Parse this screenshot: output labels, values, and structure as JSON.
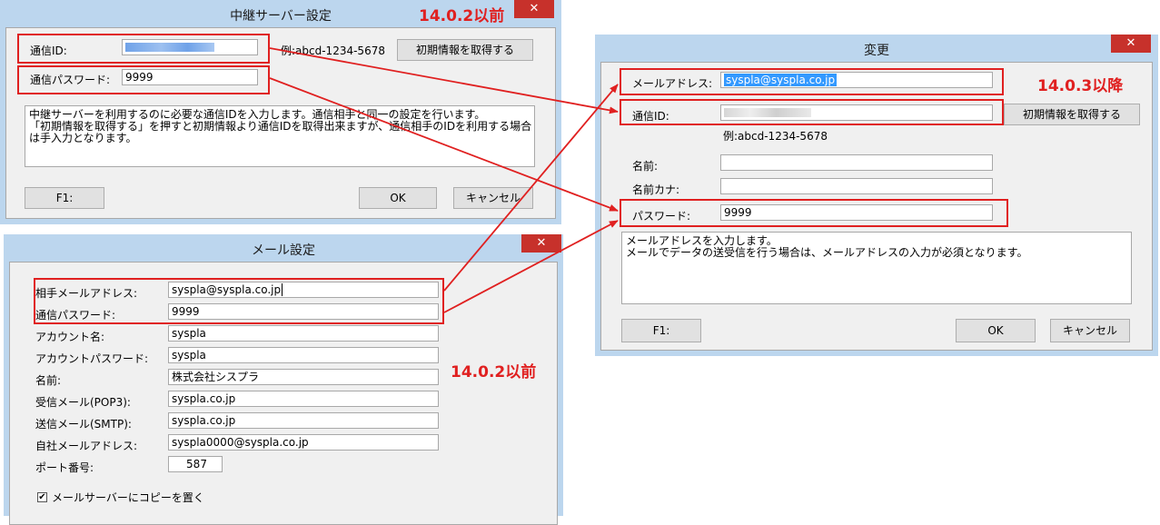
{
  "relay_dialog": {
    "title": "中継サーバー設定",
    "id_label": "通信ID:",
    "id_example": "例:abcd-1234-5678",
    "get_info_button": "初期情報を取得する",
    "password_label": "通信パスワード:",
    "password_value": "9999",
    "help_lines": [
      "中継サーバーを利用するのに必要な通信IDを入力します。通信相手と同一の設定を行います。",
      "「初期情報を取得する」を押すと初期情報より通信IDを取得出来ますが、通信相手のIDを利用する場合",
      "は手入力となります。"
    ],
    "f1_button": "F1:",
    "ok_button": "OK",
    "cancel_button": "キャンセル",
    "version_note": "14.0.2以前"
  },
  "change_dialog": {
    "title": "変更",
    "version_note": "14.0.3以降",
    "email_label": "メールアドレス:",
    "email_value": "syspla@syspla.co.jp",
    "id_label": "通信ID:",
    "get_info_button": "初期情報を取得する",
    "id_example": "例:abcd-1234-5678",
    "name_label": "名前:",
    "name_value": "",
    "kana_label": "名前カナ:",
    "kana_value": "",
    "password_label": "パスワード:",
    "password_value": "9999",
    "help_lines": [
      "メールアドレスを入力します。",
      "メールでデータの送受信を行う場合は、メールアドレスの入力が必須となります。"
    ],
    "f1_button": "F1:",
    "ok_button": "OK",
    "cancel_button": "キャンセル"
  },
  "mail_dialog": {
    "title": "メール設定",
    "version_note": "14.0.2以前",
    "fields": [
      {
        "label": "相手メールアドレス:",
        "value": "syspla@syspla.co.jp"
      },
      {
        "label": "通信パスワード:",
        "value": "9999"
      },
      {
        "label": "アカウント名:",
        "value": "syspla"
      },
      {
        "label": "アカウントパスワード:",
        "value": "syspla"
      },
      {
        "label": "名前:",
        "value": "株式会社シスプラ"
      },
      {
        "label": "受信メール(POP3):",
        "value": "syspla.co.jp"
      },
      {
        "label": "送信メール(SMTP):",
        "value": "syspla.co.jp"
      },
      {
        "label": "自社メールアドレス:",
        "value": "syspla0000@syspla.co.jp"
      }
    ],
    "port_label": "ポート番号:",
    "port_value": "587",
    "copy_checkbox_label": "メールサーバーにコピーを置く",
    "copy_checkbox_checked": true
  },
  "colors": {
    "annotation_red": "#e02020",
    "window_frame": "#bcd6ee",
    "close_button": "#c7312b",
    "selection_blue": "#3399ff"
  }
}
